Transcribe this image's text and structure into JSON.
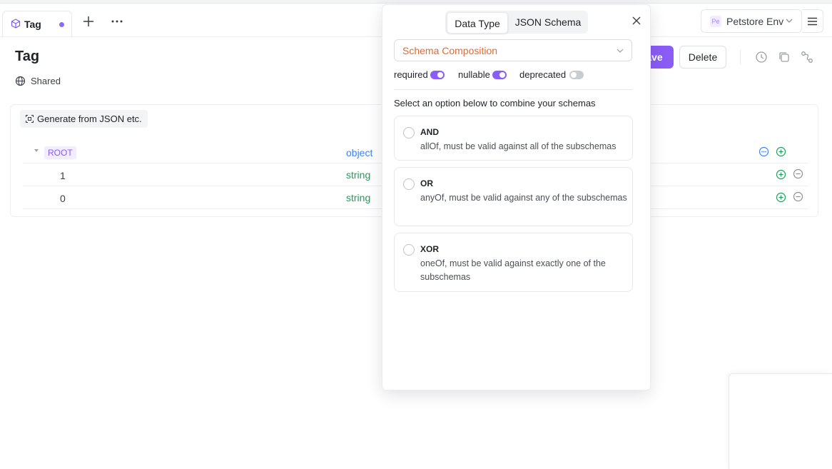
{
  "tab": {
    "label": "Tag",
    "add_icon": "plus-icon",
    "more_icon": "more-horizontal-icon"
  },
  "env": {
    "badge": "Pe",
    "label": "Petstore Env"
  },
  "header": {
    "title": "Tag",
    "shared_label": "Shared",
    "save_label": "Save",
    "save_visible": "ave",
    "delete_label": "Delete"
  },
  "schema": {
    "generate_label": "Generate from JSON etc.",
    "rows": [
      {
        "name": "ROOT",
        "type": "object"
      },
      {
        "name": "1",
        "type": "string"
      },
      {
        "name": "0",
        "type": "string"
      }
    ]
  },
  "popover": {
    "tabs": [
      "Data Type",
      "JSON Schema"
    ],
    "active_tab": "Data Type",
    "select_value": "Schema Composition",
    "flags": [
      {
        "label": "required",
        "on": true
      },
      {
        "label": "nullable",
        "on": true
      },
      {
        "label": "deprecated",
        "on": false
      }
    ],
    "hint": "Select an option below to combine your schemas",
    "options": [
      {
        "title": "AND",
        "desc": "allOf, must be valid against all of the subschemas"
      },
      {
        "title": "OR",
        "desc": "anyOf, must be valid against any of the subschemas"
      },
      {
        "title": "XOR",
        "desc": "oneOf, must be valid against exactly one of the subschemas"
      }
    ]
  },
  "colors": {
    "accent": "#8b5cf6",
    "select_text": "#e5682f",
    "string_type": "#1e9e56",
    "object_type": "#3b82f6"
  }
}
